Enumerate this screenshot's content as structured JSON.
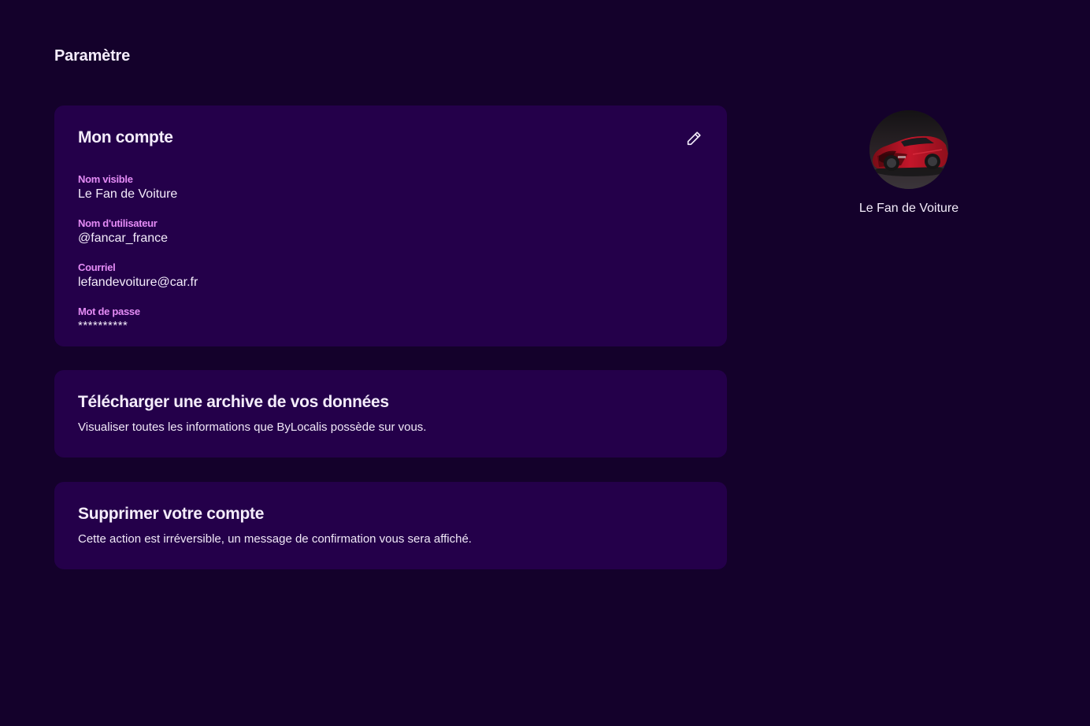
{
  "page": {
    "title": "Paramètre"
  },
  "account": {
    "title": "Mon compte",
    "edit_icon": "pencil-icon",
    "fields": [
      {
        "label": "Nom visible",
        "value": "Le Fan de Voiture"
      },
      {
        "label": "Nom d'utilisateur",
        "value": "@fancar_france"
      },
      {
        "label": "Courriel",
        "value": "lefandevoiture@car.fr"
      },
      {
        "label": "Mot de passe",
        "value": "**********"
      }
    ]
  },
  "archive": {
    "title": "Télécharger une archive de vos données",
    "description": "Visualiser toutes les informations que ByLocalis possède sur vous."
  },
  "delete": {
    "title": "Supprimer votre compte",
    "description": "Cette action est irréversible, un message de confirmation vous sera affiché."
  },
  "profile": {
    "name": "Le Fan de Voiture",
    "avatar": "red-car-avatar"
  },
  "colors": {
    "background": "#14012b",
    "card": "#24004a",
    "label_accent": "#e48cf5",
    "text": "#f4ecfb"
  }
}
